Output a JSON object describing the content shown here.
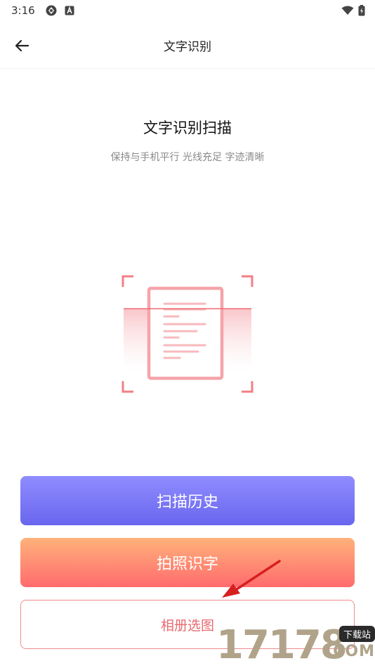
{
  "status_bar": {
    "time": "3:16",
    "left_icons": [
      "sync-icon",
      "a-badge-icon"
    ],
    "right_icons": [
      "wifi-icon",
      "battery-icon"
    ]
  },
  "app_bar": {
    "title": "文字识别",
    "back_icon": "arrow-left-icon"
  },
  "scan": {
    "title": "文字识别扫描",
    "subtitle": "保持与手机平行 光线充足 字迹清晰",
    "accent_color": "#f27f86"
  },
  "buttons": {
    "history": "扫描历史",
    "photo": "拍照识字",
    "album": "相册选图"
  },
  "colors": {
    "history_gradient": [
      "#8f8cff",
      "#6a66ee"
    ],
    "photo_gradient": [
      "#ffb27a",
      "#ff6b6e"
    ],
    "album_border": "#f08a8d",
    "annotation_arrow": "#d62020"
  },
  "watermark": {
    "digits": "17178",
    "tag": "下载站",
    "suffix": ".COM"
  }
}
